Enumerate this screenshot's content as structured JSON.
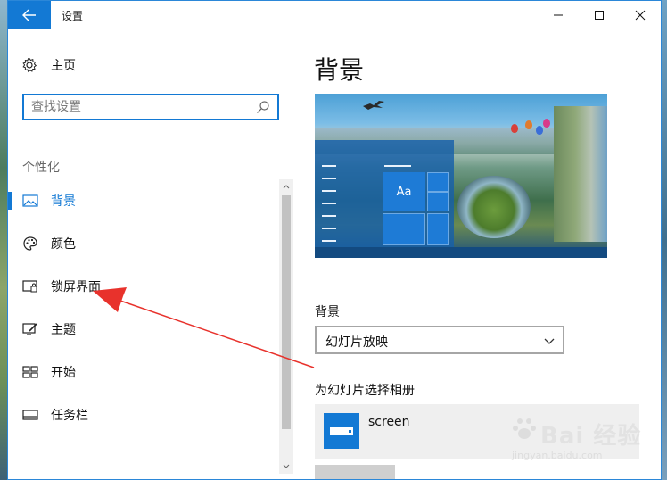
{
  "window": {
    "title": "设置"
  },
  "titlebar": {
    "back_icon": "back-arrow-icon",
    "min_icon": "minimize-icon",
    "max_icon": "maximize-icon",
    "close_icon": "close-icon",
    "accent_color": "#1379d4"
  },
  "sidebar": {
    "home_label": "主页",
    "search_placeholder": "查找设置",
    "section_title": "个性化",
    "items": [
      {
        "label": "背景",
        "icon": "picture-icon",
        "active": true
      },
      {
        "label": "颜色",
        "icon": "palette-icon",
        "active": false
      },
      {
        "label": "锁屏界面",
        "icon": "lock-screen-icon",
        "active": false
      },
      {
        "label": "主题",
        "icon": "theme-icon",
        "active": false
      },
      {
        "label": "开始",
        "icon": "start-icon",
        "active": false
      },
      {
        "label": "任务栏",
        "icon": "taskbar-icon",
        "active": false
      }
    ]
  },
  "content": {
    "page_title": "背景",
    "preview_tile_label": "Aa",
    "background_label": "背景",
    "background_value": "幻灯片放映",
    "album_label": "为幻灯片选择相册",
    "album_item": "screen"
  },
  "watermark": {
    "brand": "Bai 经验",
    "url": "jingyan.baidu.com"
  }
}
